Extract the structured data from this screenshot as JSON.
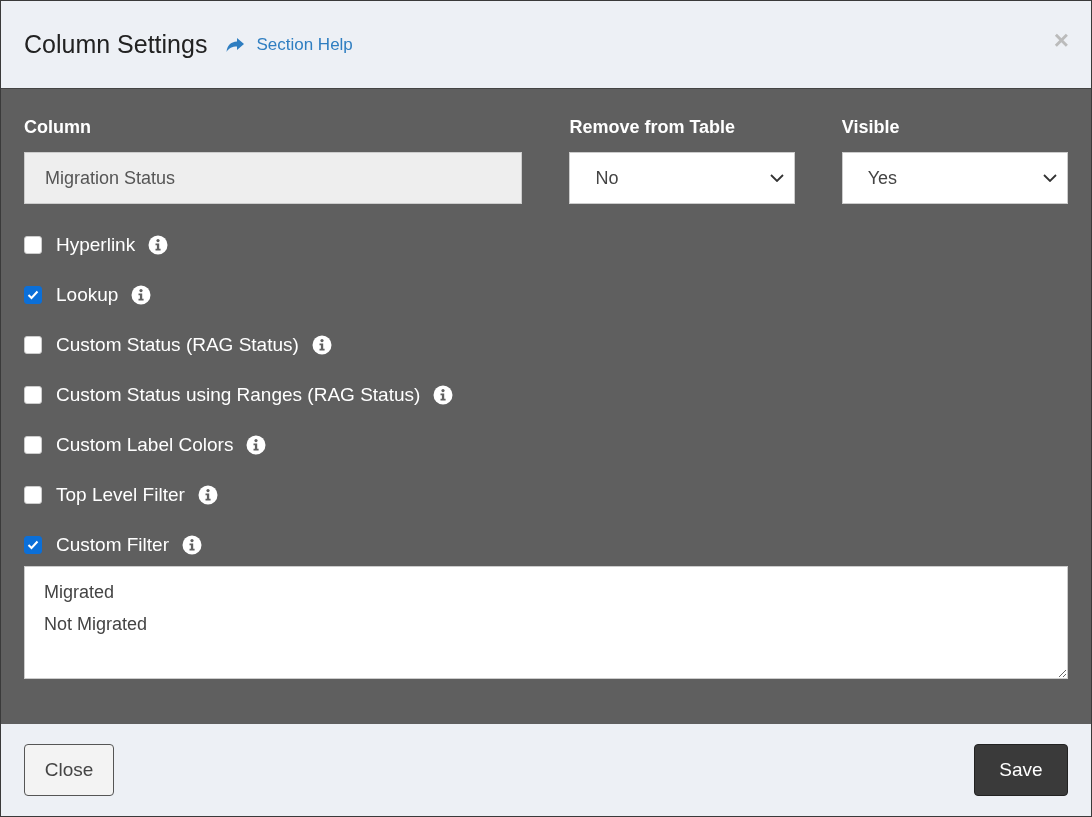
{
  "dialog": {
    "title": "Column Settings",
    "help_link": "Section Help",
    "close_icon": "×"
  },
  "fields": [
    {
      "kind": "text",
      "label": "Column",
      "value": "Migration Status"
    },
    {
      "kind": "select",
      "label": "Remove from Table",
      "value": "No"
    },
    {
      "kind": "select",
      "label": "Visible",
      "value": "Yes"
    }
  ],
  "options": [
    {
      "label": "Hyperlink",
      "checked": false
    },
    {
      "label": "Lookup",
      "checked": true
    },
    {
      "label": "Custom Status (RAG Status)",
      "checked": false
    },
    {
      "label": "Custom Status using Ranges (RAG Status)",
      "checked": false
    },
    {
      "label": "Custom Label Colors",
      "checked": false
    },
    {
      "label": "Top Level Filter",
      "checked": false
    },
    {
      "label": "Custom Filter",
      "checked": true
    }
  ],
  "filter_values": [
    "Migrated",
    "Not Migrated"
  ],
  "buttons": [
    {
      "kind": "secondary",
      "label": "Close"
    },
    {
      "kind": "primary",
      "label": "Save"
    }
  ]
}
